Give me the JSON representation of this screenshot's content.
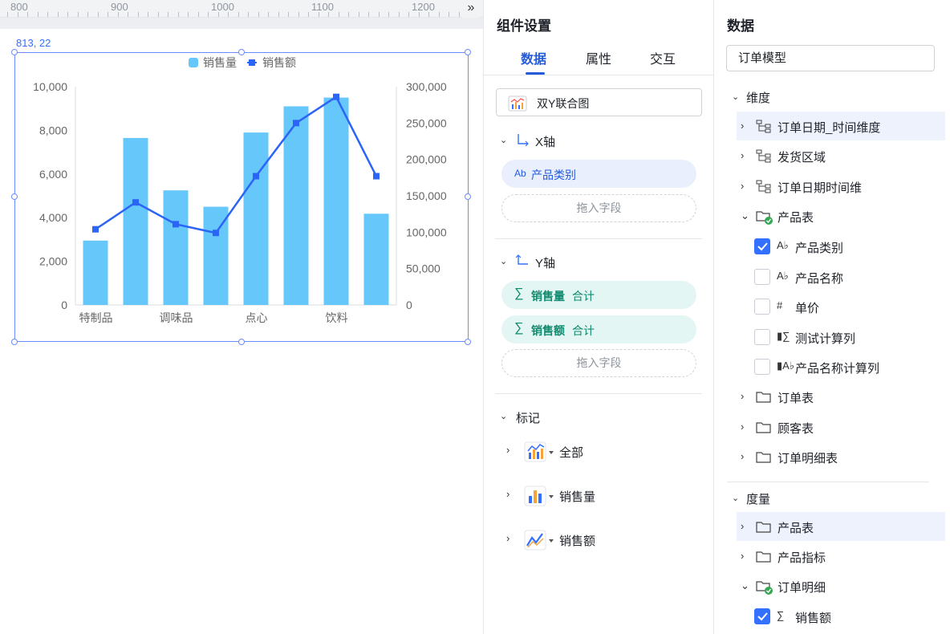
{
  "ruler": {
    "labels": [
      "800",
      "900",
      "1000",
      "1100",
      "1200"
    ]
  },
  "canvas": {
    "coord_readout": "813, 22"
  },
  "chart_data": {
    "type": "bar",
    "title": "",
    "legend": [
      "销售量",
      "销售额"
    ],
    "legend_position": "top",
    "categories": [
      "特制品",
      "",
      "调味品",
      "",
      "点心",
      "",
      "饮料",
      ""
    ],
    "series": [
      {
        "name": "销售量",
        "type": "bar",
        "axis": "left",
        "color": "#66c7fb",
        "values": [
          2950,
          7650,
          5250,
          4500,
          7900,
          9100,
          9500,
          4180
        ]
      },
      {
        "name": "销售额",
        "type": "line",
        "axis": "right",
        "color": "#2c64f6",
        "values": [
          104000,
          141000,
          111000,
          99000,
          177000,
          250000,
          286000,
          177000
        ]
      }
    ],
    "y_left": {
      "ticks": [
        "10,000",
        "8,000",
        "6,000",
        "4,000",
        "2,000",
        "0"
      ],
      "range": [
        0,
        10000
      ]
    },
    "y_right": {
      "ticks": [
        "300,000",
        "250,000",
        "200,000",
        "150,000",
        "100,000",
        "50,000",
        "0"
      ],
      "range": [
        0,
        300000
      ]
    },
    "grid": false
  },
  "mid": {
    "title": "组件设置",
    "tabs": [
      "数据",
      "属性",
      "交互"
    ],
    "chart_type": "双Y联合图",
    "x_axis": {
      "label": "X轴",
      "field_prefix": "Ab",
      "field": "产品类别",
      "drop": "拖入字段"
    },
    "y_axis": {
      "label": "Y轴",
      "fields": [
        {
          "sigma": "∑",
          "name": "销售量",
          "agg": "合计"
        },
        {
          "sigma": "∑",
          "name": "销售额",
          "agg": "合计"
        }
      ],
      "drop": "拖入字段"
    },
    "marks": {
      "label": "标记",
      "items": [
        "全部",
        "销售量",
        "销售额"
      ]
    }
  },
  "right": {
    "title": "数据",
    "model": "订单模型",
    "dimension_label": "维度",
    "dim_items": [
      {
        "label": "订单日期_时间维度"
      },
      {
        "label": "发货区域"
      },
      {
        "label": "订单日期时间维"
      }
    ],
    "product_table": "产品表",
    "fields": [
      {
        "icon": "Ab",
        "label": "产品类别",
        "checked": true
      },
      {
        "icon": "Ab",
        "label": "产品名称",
        "checked": false
      },
      {
        "icon": "#",
        "label": "单价",
        "checked": false
      },
      {
        "icon": "calc",
        "label": "测试计算列",
        "checked": false
      },
      {
        "icon": "calcAb",
        "label": "产品名称计算列",
        "checked": false
      }
    ],
    "folders": [
      "订单表",
      "顾客表",
      "订单明细表"
    ],
    "measure_label": "度量",
    "measure_items": [
      "产品表",
      "产品指标",
      "订单明细"
    ],
    "measure_field": {
      "label": "销售额",
      "checked": true
    }
  }
}
